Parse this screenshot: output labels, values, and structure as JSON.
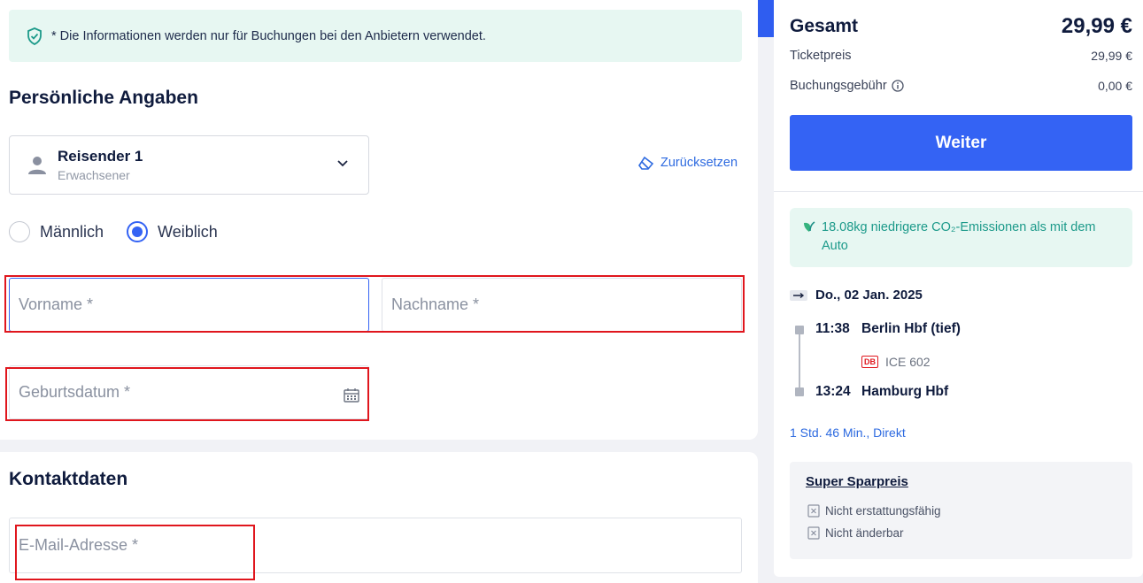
{
  "info_banner": {
    "text": "* Die Informationen werden nur für Buchungen bei den Anbietern verwendet.",
    "icon": "shield-check-icon"
  },
  "personal": {
    "title": "Persönliche Angaben",
    "traveler": {
      "name": "Reisender 1",
      "type": "Erwachsener"
    },
    "reset_label": "Zurücksetzen",
    "gender": {
      "male": "Männlich",
      "female": "Weiblich",
      "selected": "female"
    },
    "firstname_placeholder": "Vorname *",
    "lastname_placeholder": "Nachname *",
    "birthdate_placeholder": "Geburtsdatum *"
  },
  "contact": {
    "title": "Kontaktdaten",
    "email_placeholder": "E-Mail-Adresse *"
  },
  "summary": {
    "total_label": "Gesamt",
    "total_value": "29,99 €",
    "ticket_label": "Ticketpreis",
    "ticket_value": "29,99 €",
    "fee_label": "Buchungsgebühr",
    "fee_value": "0,00 €",
    "continue_label": "Weiter"
  },
  "eco": {
    "text": "18.08kg niedrigere CO₂-Emissionen als mit dem Auto"
  },
  "journey": {
    "date": "Do., 02 Jan. 2025",
    "departure_time": "11:38",
    "departure_station": "Berlin Hbf (tief)",
    "operator_badge": "DB",
    "train": "ICE 602",
    "arrival_time": "13:24",
    "arrival_station": "Hamburg Hbf",
    "duration": "1 Std. 46 Min., Direkt"
  },
  "fare": {
    "name": "Super Sparpreis",
    "conditions": [
      "Nicht erstattungsfähig",
      "Nicht änderbar"
    ]
  },
  "colors": {
    "accent": "#3463f4",
    "highlight": "#e0161d",
    "eco_bg": "#e7f7f2",
    "eco_text": "#1c9a8a"
  }
}
